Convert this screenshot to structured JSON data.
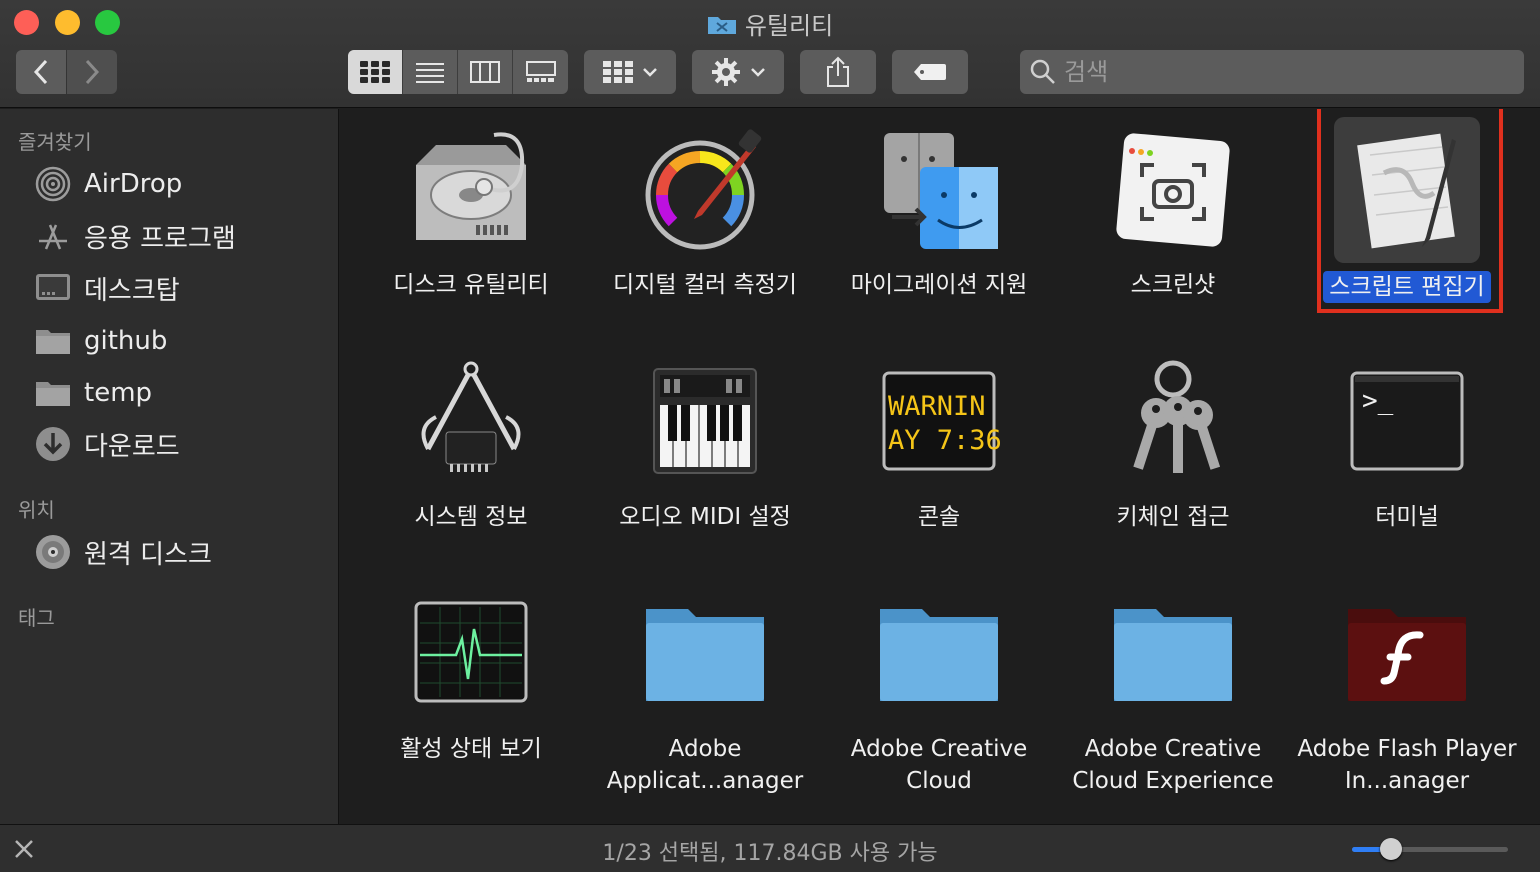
{
  "window": {
    "title": "유틸리티"
  },
  "toolbar": {
    "back": "back",
    "forward": "forward",
    "views": [
      "icon-view",
      "list-view",
      "column-view",
      "gallery-view"
    ],
    "active_view": 0,
    "search_placeholder": "검색"
  },
  "sidebar": {
    "favorites_header": "즐겨찾기",
    "favorites": [
      {
        "label": "AirDrop",
        "icon": "airdrop-icon"
      },
      {
        "label": "응용 프로그램",
        "icon": "applications-icon"
      },
      {
        "label": "데스크탑",
        "icon": "desktop-icon"
      },
      {
        "label": "github",
        "icon": "folder-icon"
      },
      {
        "label": "temp",
        "icon": "folder-icon"
      },
      {
        "label": "다운로드",
        "icon": "downloads-icon"
      }
    ],
    "locations_header": "위치",
    "locations": [
      {
        "label": "원격 디스크",
        "icon": "disc-icon"
      }
    ],
    "tags_header": "태그"
  },
  "items": [
    {
      "label": "디스크 유틸리티",
      "icon": "disk-utility-icon"
    },
    {
      "label": "디지털 컬러 측정기",
      "icon": "color-meter-icon"
    },
    {
      "label": "마이그레이션 지원",
      "icon": "migration-assistant-icon"
    },
    {
      "label": "스크린샷",
      "icon": "screenshot-icon"
    },
    {
      "label": "스크립트 편집기",
      "icon": "script-editor-icon",
      "selected": true
    },
    {
      "label": "시스템 정보",
      "icon": "system-information-icon"
    },
    {
      "label": "오디오 MIDI 설정",
      "icon": "audio-midi-icon"
    },
    {
      "label": "콘솔",
      "icon": "console-icon",
      "console_lines": [
        "WARNIN",
        "AY 7:36"
      ]
    },
    {
      "label": "키체인 접근",
      "icon": "keychain-icon"
    },
    {
      "label": "터미널",
      "icon": "terminal-icon",
      "prompt": ">_"
    },
    {
      "label": "활성 상태 보기",
      "icon": "activity-monitor-icon"
    },
    {
      "label": "Adobe Applicat...anager",
      "icon": "folder-icon"
    },
    {
      "label": "Adobe Creative Cloud",
      "icon": "folder-icon"
    },
    {
      "label": "Adobe Creative Cloud Experience",
      "icon": "folder-icon"
    },
    {
      "label": "Adobe Flash Player In...anager",
      "icon": "flash-icon"
    }
  ],
  "status": {
    "text": "1/23 선택됨, 117.84GB 사용 가능",
    "zoom": 0.25
  },
  "colors": {
    "selection": "#2159d4",
    "highlight_outline": "#e0301e",
    "folder": "#5fa8dc"
  }
}
